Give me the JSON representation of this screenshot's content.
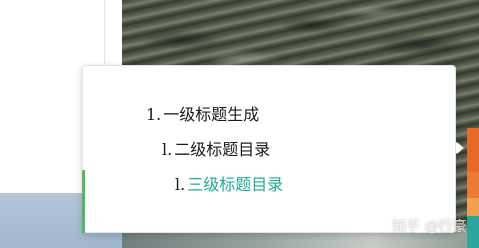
{
  "toc": {
    "items": [
      {
        "num": "1.",
        "label": "一级标题生成"
      },
      {
        "num": "l.",
        "label": "二级标题目录"
      },
      {
        "num": "l.",
        "label": "三级标题目录"
      }
    ],
    "active_index": 2
  },
  "watermark": "知乎 @行豪",
  "colors": {
    "active_text": "#1eab96",
    "marker_green": "#52b960",
    "tab_orange": "#e8682a",
    "tab_teal": "#2ba79c"
  }
}
